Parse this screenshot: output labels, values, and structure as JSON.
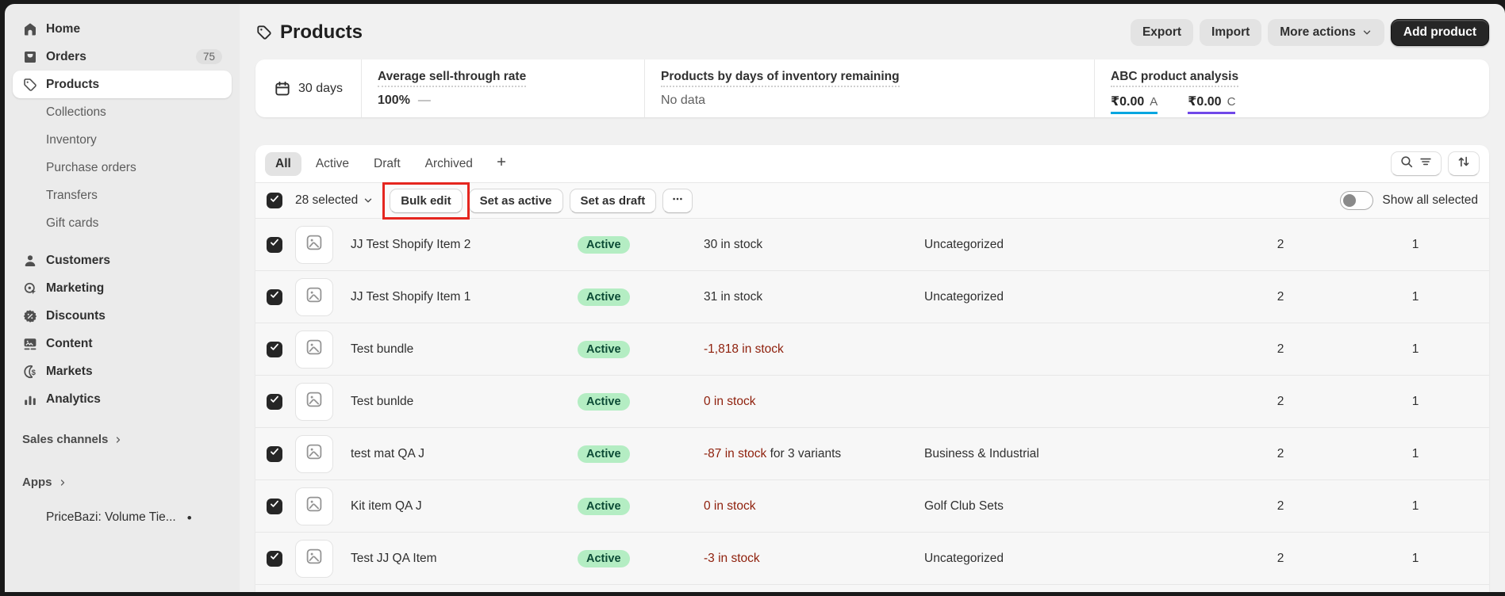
{
  "sidebar": {
    "items": [
      {
        "label": "Home",
        "icon": "home-icon"
      },
      {
        "label": "Orders",
        "icon": "orders-icon",
        "badge": "75"
      },
      {
        "label": "Products",
        "icon": "products-icon",
        "selected": true
      },
      {
        "label": "Collections",
        "child": true
      },
      {
        "label": "Inventory",
        "child": true
      },
      {
        "label": "Purchase orders",
        "child": true
      },
      {
        "label": "Transfers",
        "child": true
      },
      {
        "label": "Gift cards",
        "child": true
      },
      {
        "label": "Customers",
        "icon": "customers-icon",
        "gap": true
      },
      {
        "label": "Marketing",
        "icon": "marketing-icon"
      },
      {
        "label": "Discounts",
        "icon": "discounts-icon"
      },
      {
        "label": "Content",
        "icon": "content-icon"
      },
      {
        "label": "Markets",
        "icon": "markets-icon"
      },
      {
        "label": "Analytics",
        "icon": "analytics-icon"
      }
    ],
    "sections": {
      "sales_channels": "Sales channels",
      "apps": "Apps"
    },
    "app_item": {
      "label": "PriceBazi: Volume Tie...",
      "dot": "•"
    }
  },
  "header": {
    "title": "Products",
    "title_icon": "tag-icon",
    "export_label": "Export",
    "import_label": "Import",
    "more_actions_label": "More actions",
    "add_product_label": "Add product"
  },
  "stats": {
    "date_range": "30 days",
    "date_range_icon": "calendar-icon",
    "sell_through": {
      "title": "Average sell-through rate",
      "value": "100%",
      "dash": "—"
    },
    "inventory_days": {
      "title": "Products by days of inventory remaining",
      "value": "No data"
    },
    "abc": {
      "title": "ABC product analysis",
      "items": [
        {
          "amount": "₹0.00",
          "grade": "A",
          "color": "#00a6e0"
        },
        {
          "amount": "₹0.00",
          "grade": "C",
          "color": "#7048e8"
        }
      ]
    }
  },
  "tabs": {
    "items": [
      {
        "label": "All",
        "selected": true
      },
      {
        "label": "Active"
      },
      {
        "label": "Draft"
      },
      {
        "label": "Archived"
      }
    ],
    "add_view_icon": "plus-icon",
    "search_icon": "search-icon",
    "filter_icon": "filter-icon",
    "sort_icon": "sort-icon"
  },
  "bulk": {
    "selected_label": "28 selected",
    "actions": [
      {
        "label": "Bulk edit",
        "annotated": true
      },
      {
        "label": "Set as active"
      },
      {
        "label": "Set as draft"
      }
    ],
    "more_icon": "dots-icon",
    "toggle_label": "Show all selected",
    "toggle_state": "off"
  },
  "table": {
    "rows": [
      {
        "name": "JJ Test Shopify Item 2",
        "status": "Active",
        "stock": "30 in stock",
        "stock_critical": false,
        "stock_suffix": "",
        "category": "Uncategorized",
        "variants_count": "2",
        "channels_count": "1"
      },
      {
        "name": "JJ Test Shopify Item 1",
        "status": "Active",
        "stock": "31 in stock",
        "stock_critical": false,
        "stock_suffix": "",
        "category": "Uncategorized",
        "variants_count": "2",
        "channels_count": "1"
      },
      {
        "name": "Test bundle",
        "status": "Active",
        "stock": "-1,818 in stock",
        "stock_critical": true,
        "stock_suffix": "",
        "category": "",
        "variants_count": "2",
        "channels_count": "1"
      },
      {
        "name": "Test bunlde",
        "status": "Active",
        "stock": "0 in stock",
        "stock_critical": true,
        "stock_suffix": "",
        "category": "",
        "variants_count": "2",
        "channels_count": "1"
      },
      {
        "name": "test mat QA J",
        "status": "Active",
        "stock": "-87 in stock",
        "stock_critical": true,
        "stock_suffix": " for 3 variants",
        "category": "Business & Industrial",
        "variants_count": "2",
        "channels_count": "1"
      },
      {
        "name": "Kit item QA J",
        "status": "Active",
        "stock": "0 in stock",
        "stock_critical": true,
        "stock_suffix": "",
        "category": "Golf Club Sets",
        "variants_count": "2",
        "channels_count": "1"
      },
      {
        "name": "Test JJ QA Item",
        "status": "Active",
        "stock": "-3 in stock",
        "stock_critical": true,
        "stock_suffix": "",
        "category": "Uncategorized",
        "variants_count": "2",
        "channels_count": "1"
      }
    ]
  },
  "colors": {
    "accent_dark": "#262626",
    "badge_success_bg": "#b4edc3",
    "badge_success_text": "#0b4a35",
    "critical_text": "#8e1f0b",
    "annotation_red": "#e5261f",
    "abc_a_underline": "#00a6e0",
    "abc_c_underline": "#7048e8"
  }
}
